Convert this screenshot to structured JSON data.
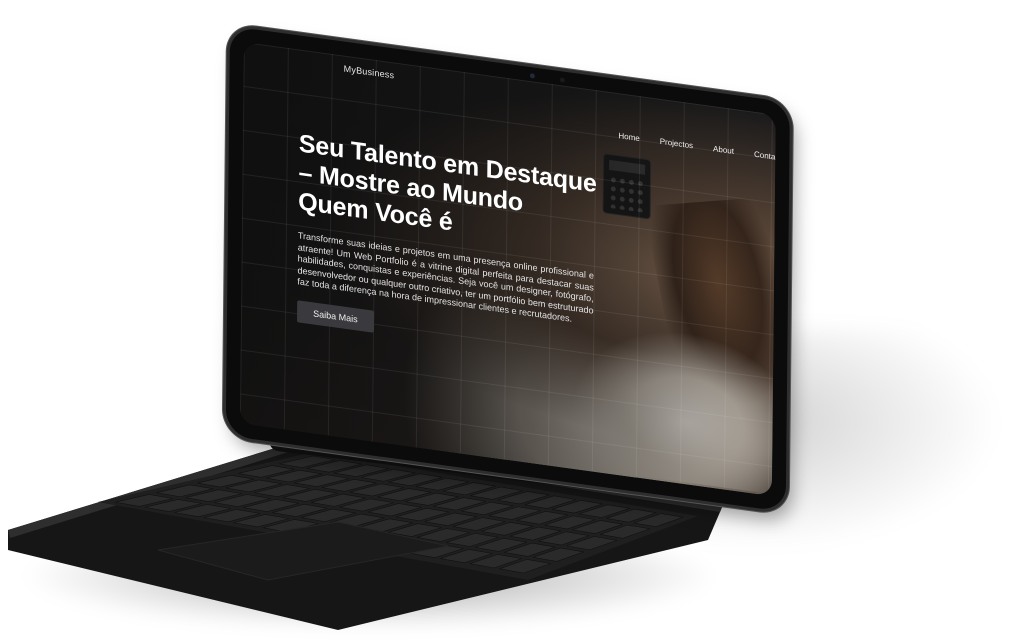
{
  "site": {
    "brand": "MyBusiness",
    "nav": {
      "home": "Home",
      "projects": "Projectos",
      "about": "About",
      "contact": "Contacte"
    },
    "hero": {
      "title": "Seu Talento em Destaque – Mostre ao Mundo Quem Você é",
      "body": "Transforme suas ideias e projetos em uma presença online profissional e atraente! Um Web Portfolio é a vitrine digital perfeita para destacar suas habilidades, conquistas e experiências. Seja você um designer, fotógrafo, desenvolvedor ou qualquer outro criativo, ter um portfólio bem estruturado faz toda a diferença na hora de impressionar clientes e recrutadores.",
      "cta": "Saiba Mais"
    }
  },
  "colors": {
    "device": "#0b0b0b",
    "button": "#3a3a3e",
    "text": "#ffffff"
  }
}
